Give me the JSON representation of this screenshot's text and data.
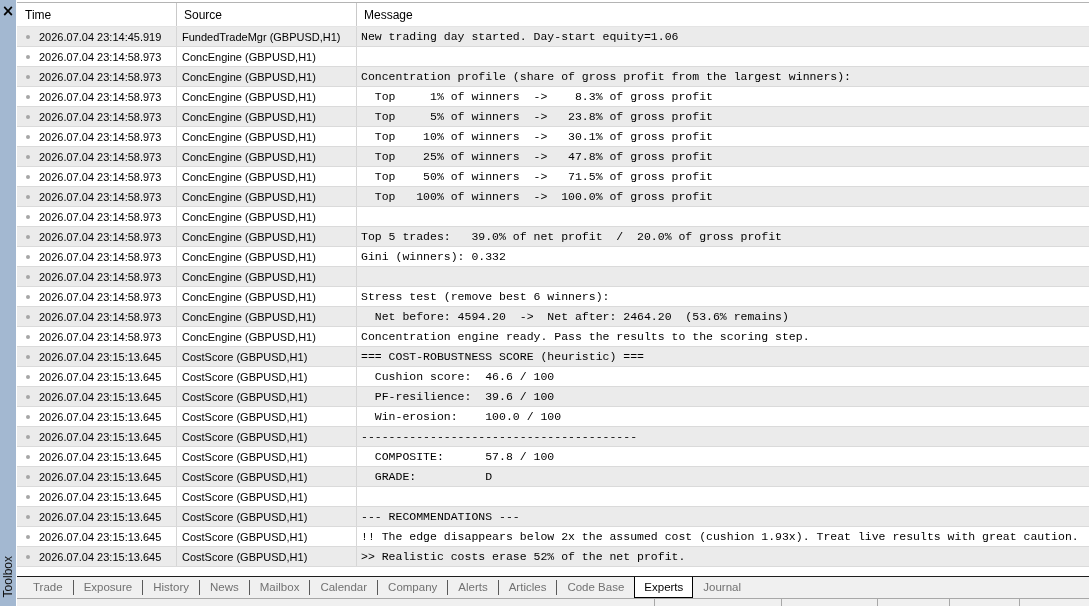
{
  "toolbox": {
    "close_button": "×",
    "title": "Toolbox"
  },
  "log": {
    "columns": [
      "Time",
      "Source",
      "Message"
    ],
    "rows": [
      {
        "time": "2026.07.04 23:14:45.919",
        "source": "FundedTradeMgr (GBPUSD,H1)",
        "message": "New trading day started. Day-start equity=1.06"
      },
      {
        "time": "2026.07.04 23:14:58.973",
        "source": "ConcEngine (GBPUSD,H1)"
      },
      {
        "time": "2026.07.04 23:14:58.973",
        "source": "ConcEngine (GBPUSD,H1)",
        "message": "Concentration profile (share of gross profit from the largest winners):"
      },
      {
        "time": "2026.07.04 23:14:58.973",
        "source": "ConcEngine (GBPUSD,H1)",
        "message": "  Top     1% of winners  ->    8.3% of gross profit"
      },
      {
        "time": "2026.07.04 23:14:58.973",
        "source": "ConcEngine (GBPUSD,H1)",
        "message": "  Top     5% of winners  ->   23.8% of gross profit"
      },
      {
        "time": "2026.07.04 23:14:58.973",
        "source": "ConcEngine (GBPUSD,H1)",
        "message": "  Top    10% of winners  ->   30.1% of gross profit"
      },
      {
        "time": "2026.07.04 23:14:58.973",
        "source": "ConcEngine (GBPUSD,H1)",
        "message": "  Top    25% of winners  ->   47.8% of gross profit"
      },
      {
        "time": "2026.07.04 23:14:58.973",
        "source": "ConcEngine (GBPUSD,H1)",
        "message": "  Top    50% of winners  ->   71.5% of gross profit"
      },
      {
        "time": "2026.07.04 23:14:58.973",
        "source": "ConcEngine (GBPUSD,H1)",
        "message": "  Top   100% of winners  ->  100.0% of gross profit"
      },
      {
        "time": "2026.07.04 23:14:58.973",
        "source": "ConcEngine (GBPUSD,H1)"
      },
      {
        "time": "2026.07.04 23:14:58.973",
        "source": "ConcEngine (GBPUSD,H1)",
        "message": "Top 5 trades:   39.0% of net profit  /  20.0% of gross profit"
      },
      {
        "time": "2026.07.04 23:14:58.973",
        "source": "ConcEngine (GBPUSD,H1)",
        "message": "Gini (winners): 0.332"
      },
      {
        "time": "2026.07.04 23:14:58.973",
        "source": "ConcEngine (GBPUSD,H1)"
      },
      {
        "time": "2026.07.04 23:14:58.973",
        "source": "ConcEngine (GBPUSD,H1)",
        "message": "Stress test (remove best 6 winners):"
      },
      {
        "time": "2026.07.04 23:14:58.973",
        "source": "ConcEngine (GBPUSD,H1)",
        "message": "  Net before: 4594.20  ->  Net after: 2464.20  (53.6% remains)"
      },
      {
        "time": "2026.07.04 23:14:58.973",
        "source": "ConcEngine (GBPUSD,H1)",
        "message": "Concentration engine ready. Pass the results to the scoring step."
      },
      {
        "time": "2026.07.04 23:15:13.645",
        "source": "CostScore (GBPUSD,H1)",
        "message": "=== COST-ROBUSTNESS SCORE (heuristic) ==="
      },
      {
        "time": "2026.07.04 23:15:13.645",
        "source": "CostScore (GBPUSD,H1)",
        "message": "  Cushion score:  46.6 / 100"
      },
      {
        "time": "2026.07.04 23:15:13.645",
        "source": "CostScore (GBPUSD,H1)",
        "message": "  PF-resilience:  39.6 / 100"
      },
      {
        "time": "2026.07.04 23:15:13.645",
        "source": "CostScore (GBPUSD,H1)",
        "message": "  Win-erosion:    100.0 / 100"
      },
      {
        "time": "2026.07.04 23:15:13.645",
        "source": "CostScore (GBPUSD,H1)",
        "message": "----------------------------------------"
      },
      {
        "time": "2026.07.04 23:15:13.645",
        "source": "CostScore (GBPUSD,H1)",
        "message": "  COMPOSITE:      57.8 / 100"
      },
      {
        "time": "2026.07.04 23:15:13.645",
        "source": "CostScore (GBPUSD,H1)",
        "message": "  GRADE:          D"
      },
      {
        "time": "2026.07.04 23:15:13.645",
        "source": "CostScore (GBPUSD,H1)"
      },
      {
        "time": "2026.07.04 23:15:13.645",
        "source": "CostScore (GBPUSD,H1)",
        "message": "--- RECOMMENDATIONS ---"
      },
      {
        "time": "2026.07.04 23:15:13.645",
        "source": "CostScore (GBPUSD,H1)",
        "message": "!! The edge disappears below 2x the assumed cost (cushion 1.93x). Treat live results with great caution."
      },
      {
        "time": "2026.07.04 23:15:13.645",
        "source": "CostScore (GBPUSD,H1)",
        "message": ">> Realistic costs erase 52% of the net profit."
      }
    ]
  },
  "tabs": [
    {
      "label": "Trade",
      "selected": false
    },
    {
      "label": "Exposure",
      "selected": false
    },
    {
      "label": "History",
      "selected": false
    },
    {
      "label": "News",
      "selected": false
    },
    {
      "label": "Mailbox",
      "selected": false
    },
    {
      "label": "Calendar",
      "selected": false
    },
    {
      "label": "Company",
      "selected": false
    },
    {
      "label": "Alerts",
      "selected": false
    },
    {
      "label": "Articles",
      "selected": false
    },
    {
      "label": "Code Base",
      "selected": false
    },
    {
      "label": "Experts",
      "selected": true
    },
    {
      "label": "Journal",
      "selected": false
    }
  ]
}
